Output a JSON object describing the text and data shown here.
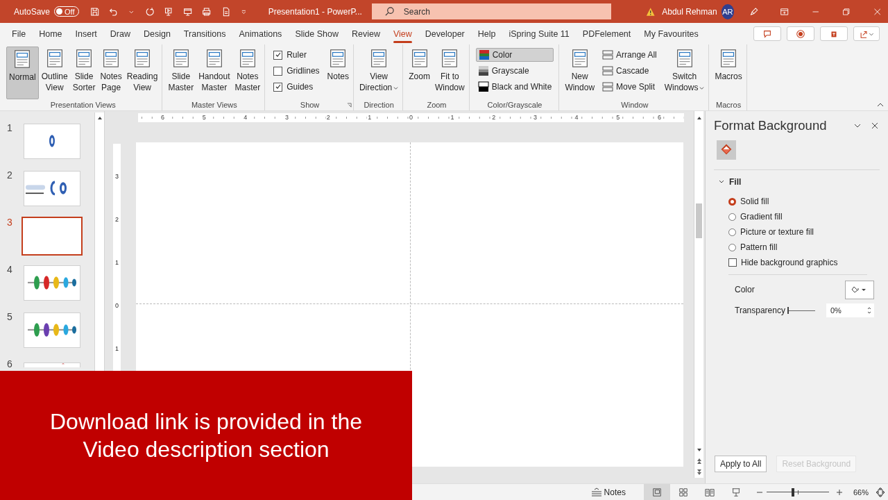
{
  "title_bar": {
    "autosave_label": "AutoSave",
    "autosave_state": "Off",
    "autosave_on": false,
    "document_title": "Presentation1  -  PowerP...",
    "search_placeholder": "Search",
    "user_name": "Abdul Rehman",
    "avatar_initials": "AR"
  },
  "menu_tabs": [
    {
      "label": "File",
      "selected": false
    },
    {
      "label": "Home",
      "selected": false
    },
    {
      "label": "Insert",
      "selected": false
    },
    {
      "label": "Draw",
      "selected": false
    },
    {
      "label": "Design",
      "selected": false
    },
    {
      "label": "Transitions",
      "selected": false
    },
    {
      "label": "Animations",
      "selected": false
    },
    {
      "label": "Slide Show",
      "selected": false
    },
    {
      "label": "Review",
      "selected": false
    },
    {
      "label": "View",
      "selected": true
    },
    {
      "label": "Developer",
      "selected": false
    },
    {
      "label": "Help",
      "selected": false
    },
    {
      "label": "iSpring Suite 11",
      "selected": false
    },
    {
      "label": "PDFelement",
      "selected": false
    },
    {
      "label": "My Favourites",
      "selected": false
    }
  ],
  "ribbon_groups": [
    {
      "label": "Presentation Views",
      "items": [
        {
          "kind": "large",
          "lines": [
            "Normal"
          ],
          "selected": true,
          "dropdown": false
        },
        {
          "kind": "large",
          "lines": [
            "Outline",
            "View"
          ],
          "selected": false,
          "dropdown": false
        },
        {
          "kind": "large",
          "lines": [
            "Slide",
            "Sorter"
          ],
          "selected": false,
          "dropdown": false
        },
        {
          "kind": "large",
          "lines": [
            "Notes",
            "Page"
          ],
          "selected": false,
          "dropdown": false
        },
        {
          "kind": "large",
          "lines": [
            "Reading",
            "View"
          ],
          "selected": false,
          "dropdown": false
        }
      ]
    },
    {
      "label": "Master Views",
      "items": [
        {
          "kind": "large",
          "lines": [
            "Slide",
            "Master"
          ],
          "selected": false,
          "dropdown": false
        },
        {
          "kind": "large",
          "lines": [
            "Handout",
            "Master"
          ],
          "selected": false,
          "dropdown": false
        },
        {
          "kind": "large",
          "lines": [
            "Notes",
            "Master"
          ],
          "selected": false,
          "dropdown": false
        }
      ]
    },
    {
      "label": "Show",
      "items": [
        {
          "kind": "stack",
          "entries": [
            {
              "kind": "check",
              "label": "Ruler",
              "checked": true
            },
            {
              "kind": "check",
              "label": "Gridlines",
              "checked": false
            },
            {
              "kind": "check",
              "label": "Guides",
              "checked": true
            }
          ]
        },
        {
          "kind": "large",
          "lines": [
            "Notes"
          ],
          "selected": false,
          "dropdown": false
        },
        {
          "kind": "launcher"
        }
      ]
    },
    {
      "label": "Direction",
      "items": [
        {
          "kind": "large",
          "lines": [
            "View",
            "Direction"
          ],
          "selected": false,
          "dropdown": true
        }
      ]
    },
    {
      "label": "Zoom",
      "items": [
        {
          "kind": "large",
          "lines": [
            "Zoom"
          ],
          "selected": false,
          "dropdown": false
        },
        {
          "kind": "large",
          "lines": [
            "Fit to",
            "Window"
          ],
          "selected": false,
          "dropdown": false
        }
      ]
    },
    {
      "label": "Color/Grayscale",
      "items": [
        {
          "kind": "stack",
          "entries": [
            {
              "kind": "option",
              "label": "Color",
              "selected": true
            },
            {
              "kind": "option",
              "label": "Grayscale",
              "selected": false
            },
            {
              "kind": "option",
              "label": "Black and White",
              "selected": false
            }
          ]
        }
      ]
    },
    {
      "label": "Window",
      "items": [
        {
          "kind": "large",
          "lines": [
            "New",
            "Window"
          ],
          "selected": false,
          "dropdown": false
        },
        {
          "kind": "stack",
          "entries": [
            {
              "kind": "plain",
              "label": "Arrange All"
            },
            {
              "kind": "plain",
              "label": "Cascade"
            },
            {
              "kind": "plain",
              "label": "Move Split"
            }
          ]
        },
        {
          "kind": "large",
          "lines": [
            "Switch",
            "Windows"
          ],
          "selected": false,
          "dropdown": true
        }
      ]
    },
    {
      "label": "Macros",
      "items": [
        {
          "kind": "large",
          "lines": [
            "Macros"
          ],
          "selected": false,
          "dropdown": false
        }
      ]
    }
  ],
  "slides": [
    {
      "number": "1",
      "kind": "ring",
      "selected": false
    },
    {
      "number": "2",
      "kind": "rings",
      "selected": false
    },
    {
      "number": "3",
      "kind": "blank",
      "selected": true
    },
    {
      "number": "4",
      "kind": "timeline",
      "selected": false
    },
    {
      "number": "5",
      "kind": "timeline",
      "selected": false
    },
    {
      "number": "6",
      "kind": "cut",
      "selected": false
    }
  ],
  "horizontal_ruler": [
    "6",
    "5",
    "4",
    "3",
    "2",
    "1",
    "0",
    "1",
    "2",
    "3",
    "4",
    "5",
    "6"
  ],
  "vertical_ruler": [
    "3",
    "2",
    "1",
    "0",
    "1"
  ],
  "format_pane": {
    "title": "Format Background",
    "section": {
      "label": "Fill",
      "expanded": true
    },
    "fill_options": [
      {
        "label": "Solid fill",
        "selected": true
      },
      {
        "label": "Gradient fill",
        "selected": false
      },
      {
        "label": "Picture or texture fill",
        "selected": false
      },
      {
        "label": "Pattern fill",
        "selected": false
      }
    ],
    "hide_graphics": {
      "label": "Hide background graphics",
      "checked": false
    },
    "color_label": "Color",
    "transparency_label": "Transparency",
    "transparency": {
      "level": 0
    },
    "transparency_value": "0%",
    "buttons": [
      {
        "label": "Apply to All",
        "disabled": false
      },
      {
        "label": "Reset Background",
        "disabled": true
      }
    ]
  },
  "status_bar": {
    "notes_label": "Notes",
    "views": [
      {
        "selected": true
      },
      {
        "selected": false
      },
      {
        "selected": false
      },
      {
        "selected": false
      }
    ],
    "zoom": {
      "level": 0.42
    },
    "zoom_reading": "66%"
  },
  "banner": {
    "text": "Download link is provided in the Video description section"
  }
}
